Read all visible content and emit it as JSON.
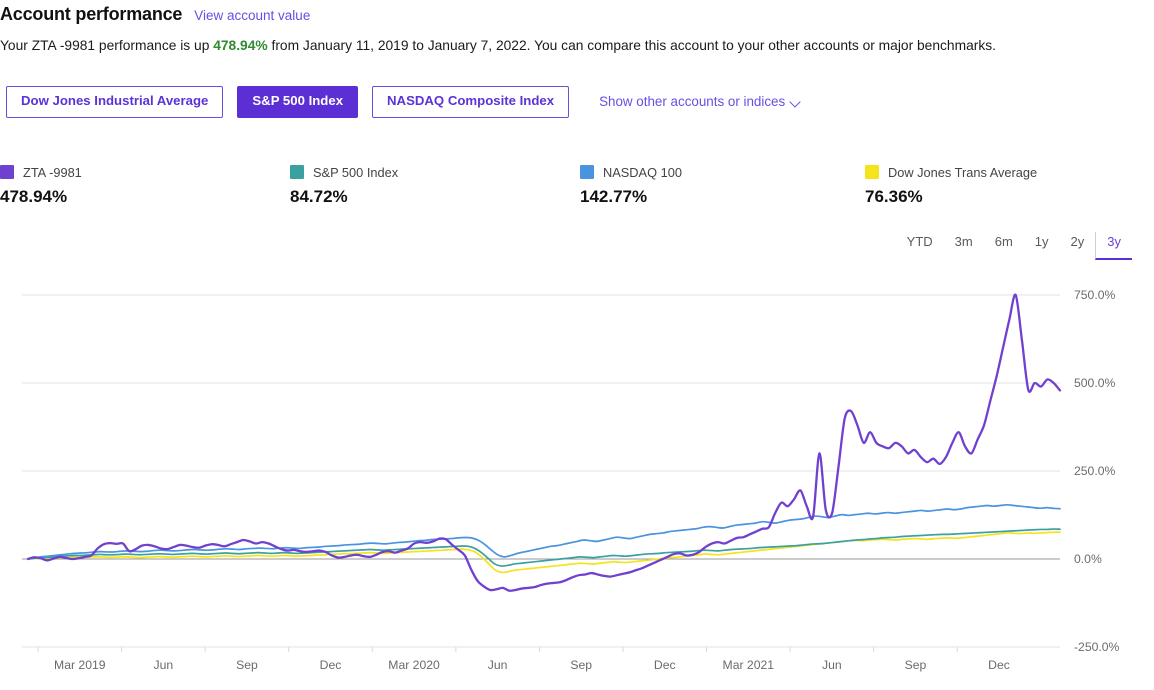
{
  "header": {
    "title": "Account performance",
    "view_link": "View account value",
    "summary_prefix": "Your ZTA -9981 performance is up ",
    "summary_pct": "478.94%",
    "summary_suffix": " from January 11, 2019 to January 7, 2022. You can compare this account to your other accounts or major benchmarks."
  },
  "benchmarks": {
    "buttons": [
      {
        "label": "Dow Jones Industrial Average",
        "active": false
      },
      {
        "label": "S&P 500 Index",
        "active": true
      },
      {
        "label": "NASDAQ Composite Index",
        "active": false
      }
    ],
    "show_other_label": "Show other accounts or indices",
    "chevron_icon": "chevron-down-icon"
  },
  "legend": [
    {
      "name": "ZTA -9981",
      "value": "478.94%",
      "color": "#7040cf",
      "x": 0
    },
    {
      "name": "S&P 500 Index",
      "value": "84.72%",
      "color": "#3ba0a0",
      "x": 290
    },
    {
      "name": "NASDAQ 100",
      "value": "142.77%",
      "color": "#4a93de",
      "x": 580
    },
    {
      "name": "Dow Jones Trans Average",
      "value": "76.36%",
      "color": "#f5e41a",
      "x": 865
    }
  ],
  "range_tabs": [
    {
      "label": "YTD",
      "active": false
    },
    {
      "label": "3m",
      "active": false
    },
    {
      "label": "6m",
      "active": false
    },
    {
      "label": "1y",
      "active": false
    },
    {
      "label": "2y",
      "active": false
    },
    {
      "label": "3y",
      "active": true
    }
  ],
  "chart_data": {
    "type": "line",
    "title": "",
    "xlabel": "",
    "ylabel": "",
    "ylim": [
      -250,
      750
    ],
    "yticks": [
      750,
      500,
      250,
      0,
      -250
    ],
    "ytick_labels": [
      "750.0%",
      "500.0%",
      "250.0%",
      "0.0%",
      "-250.0%"
    ],
    "grid": true,
    "legend_position": "above-chart",
    "xtick_labels": [
      "Mar 2019",
      "Jun",
      "Sep",
      "Dec",
      "Mar 2020",
      "Jun",
      "Sep",
      "Dec",
      "Mar 2021",
      "Jun",
      "Sep",
      "Dec"
    ],
    "x_start": "2019-01-11",
    "x_end": "2022-01-07",
    "n_points": 157,
    "series": [
      {
        "name": "ZTA -9981",
        "color": "#7040cf",
        "values": [
          0,
          5,
          2,
          -4,
          1,
          6,
          3,
          0,
          2,
          6,
          10,
          30,
          42,
          45,
          43,
          44,
          22,
          28,
          38,
          40,
          36,
          30,
          28,
          34,
          40,
          38,
          34,
          32,
          38,
          42,
          40,
          36,
          42,
          48,
          54,
          50,
          44,
          48,
          44,
          36,
          28,
          24,
          26,
          22,
          20,
          22,
          24,
          20,
          10,
          4,
          6,
          10,
          12,
          8,
          6,
          12,
          20,
          22,
          18,
          24,
          30,
          44,
          48,
          46,
          50,
          58,
          56,
          40,
          26,
          10,
          -30,
          -62,
          -78,
          -88,
          -86,
          -82,
          -90,
          -88,
          -84,
          -82,
          -80,
          -74,
          -70,
          -68,
          -66,
          -60,
          -52,
          -46,
          -44,
          -40,
          -44,
          -48,
          -50,
          -46,
          -42,
          -38,
          -32,
          -26,
          -18,
          -10,
          -2,
          6,
          14,
          16,
          10,
          12,
          20,
          34,
          44,
          48,
          44,
          52,
          60,
          62,
          70,
          78,
          86,
          90,
          130,
          160,
          150,
          170,
          195,
          150,
          120,
          300,
          140,
          130,
          260,
          400,
          420,
          380,
          330,
          360,
          330,
          320,
          315,
          330,
          320,
          300,
          310,
          290,
          275,
          285,
          270,
          290,
          330,
          360,
          320,
          300,
          340,
          380,
          450,
          520,
          600,
          680,
          750,
          620,
          480,
          500,
          490,
          510,
          500,
          478.94
        ]
      },
      {
        "name": "S&P 500 Index",
        "color": "#3ba0a0",
        "values": [
          0,
          2,
          4,
          5,
          6,
          8,
          9,
          10,
          10,
          11,
          12,
          13,
          12,
          12,
          13,
          14,
          13,
          12,
          13,
          14,
          15,
          14,
          13,
          14,
          15,
          16,
          15,
          14,
          15,
          16,
          17,
          16,
          15,
          16,
          17,
          18,
          17,
          16,
          17,
          18,
          17,
          16,
          17,
          18,
          19,
          20,
          21,
          22,
          23,
          24,
          25,
          26,
          27,
          26,
          25,
          26,
          27,
          28,
          29,
          30,
          31,
          32,
          33,
          34,
          35,
          36,
          37,
          36,
          30,
          18,
          2,
          -14,
          -20,
          -18,
          -14,
          -12,
          -10,
          -8,
          -6,
          -4,
          -2,
          0,
          2,
          4,
          6,
          5,
          4,
          6,
          8,
          10,
          9,
          8,
          10,
          12,
          14,
          15,
          16,
          18,
          19,
          20,
          21,
          22,
          24,
          25,
          24,
          23,
          25,
          27,
          28,
          29,
          30,
          32,
          33,
          34,
          35,
          36,
          37,
          38,
          40,
          42,
          43,
          44,
          46,
          48,
          50,
          52,
          54,
          55,
          57,
          58,
          60,
          61,
          62,
          64,
          65,
          66,
          67,
          68,
          69,
          70,
          70,
          71,
          72,
          73,
          74,
          75,
          76,
          77,
          78,
          79,
          80,
          81,
          82,
          83,
          84,
          84,
          85,
          84.72
        ]
      },
      {
        "name": "NASDAQ 100",
        "color": "#4a93de",
        "values": [
          0,
          3,
          6,
          8,
          10,
          12,
          14,
          16,
          17,
          18,
          20,
          21,
          20,
          20,
          22,
          23,
          22,
          21,
          22,
          24,
          25,
          24,
          23,
          24,
          26,
          27,
          26,
          25,
          26,
          28,
          29,
          28,
          27,
          29,
          30,
          31,
          30,
          29,
          31,
          32,
          31,
          30,
          32,
          33,
          34,
          36,
          37,
          38,
          40,
          41,
          42,
          44,
          45,
          44,
          43,
          45,
          47,
          48,
          50,
          52,
          53,
          55,
          56,
          57,
          58,
          60,
          61,
          60,
          54,
          42,
          26,
          12,
          6,
          10,
          16,
          20,
          24,
          28,
          32,
          36,
          38,
          42,
          46,
          50,
          54,
          52,
          50,
          54,
          58,
          62,
          60,
          58,
          62,
          66,
          70,
          72,
          74,
          78,
          80,
          82,
          84,
          86,
          90,
          92,
          90,
          88,
          92,
          96,
          98,
          100,
          102,
          106,
          104,
          102,
          106,
          110,
          112,
          114,
          118,
          122,
          120,
          118,
          122,
          126,
          124,
          126,
          128,
          130,
          128,
          130,
          132,
          130,
          132,
          134,
          136,
          138,
          136,
          138,
          140,
          142,
          140,
          142,
          146,
          148,
          150,
          152,
          150,
          152,
          154,
          152,
          150,
          148,
          146,
          144,
          146,
          144,
          142.77
        ]
      },
      {
        "name": "Dow Jones Trans Average",
        "color": "#f5e41a",
        "values": [
          0,
          1,
          2,
          3,
          3,
          4,
          4,
          5,
          5,
          5,
          6,
          6,
          5,
          5,
          6,
          6,
          5,
          4,
          5,
          6,
          7,
          6,
          5,
          6,
          7,
          8,
          7,
          6,
          7,
          8,
          9,
          8,
          7,
          8,
          9,
          10,
          9,
          8,
          9,
          10,
          9,
          8,
          9,
          10,
          11,
          12,
          13,
          14,
          15,
          15,
          16,
          17,
          18,
          17,
          16,
          17,
          18,
          19,
          20,
          21,
          22,
          23,
          24,
          25,
          26,
          27,
          28,
          26,
          20,
          6,
          -12,
          -30,
          -38,
          -36,
          -32,
          -30,
          -28,
          -26,
          -24,
          -22,
          -20,
          -18,
          -16,
          -14,
          -12,
          -13,
          -14,
          -12,
          -10,
          -8,
          -9,
          -10,
          -8,
          -6,
          -4,
          -2,
          0,
          2,
          4,
          6,
          8,
          10,
          12,
          14,
          13,
          12,
          14,
          16,
          18,
          20,
          22,
          24,
          26,
          28,
          30,
          32,
          34,
          36,
          38,
          40,
          42,
          44,
          46,
          48,
          50,
          52,
          53,
          52,
          54,
          55,
          56,
          55,
          54,
          56,
          57,
          58,
          57,
          56,
          58,
          59,
          60,
          59,
          60,
          62,
          64,
          66,
          68,
          70,
          72,
          74,
          73,
          72,
          74,
          73,
          74,
          75,
          76,
          76.36
        ]
      }
    ]
  }
}
